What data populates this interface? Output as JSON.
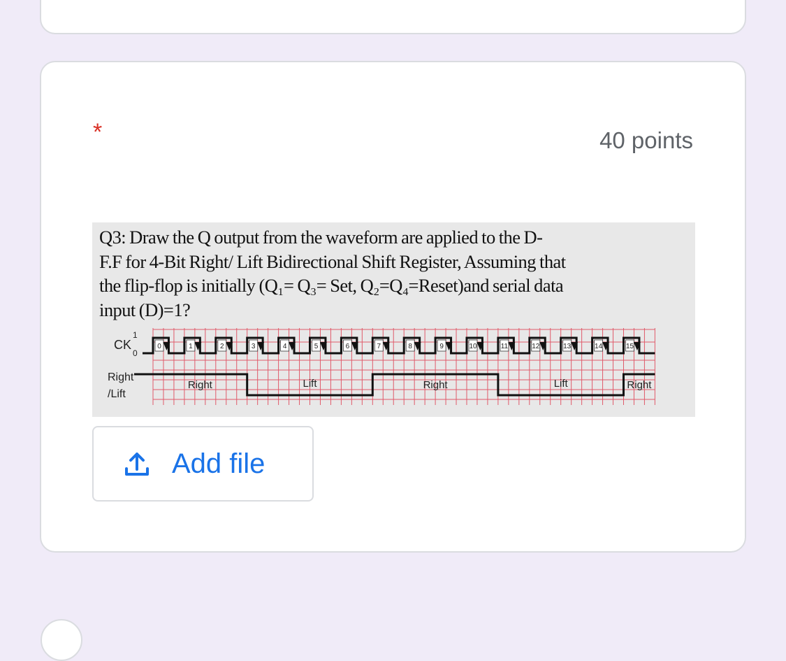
{
  "question": {
    "required_marker": "*",
    "points_label": "40 points",
    "text_lines": [
      "Q3: Draw the Q output from the waveform are  applied to the D-",
      "F.F for 4-Bit Right/ Lift Bidirectional Shift Register, Assuming that",
      "the flip-flop is initially (Q₁= Q₃= Set, Q₂=Q₄=Reset)and serial data",
      "input (D)=1?"
    ],
    "diagram": {
      "ck_label": "CK",
      "ck_high_label": "1",
      "ck_low_label": "0",
      "rl_label_line1": "Right",
      "rl_label_line2": "/Lift",
      "clock_numbers": [
        "0",
        "1",
        "2",
        "3",
        "4",
        "5",
        "6",
        "7",
        "8",
        "9",
        "10",
        "11",
        "12",
        "13",
        "14",
        "15"
      ],
      "segments": [
        {
          "label": "Right",
          "level": "high",
          "from_clock": 0,
          "to_clock": 3
        },
        {
          "label": "Lift",
          "level": "low",
          "from_clock": 3,
          "to_clock": 7
        },
        {
          "label": "Right",
          "level": "high",
          "from_clock": 7,
          "to_clock": 11
        },
        {
          "label": "Lift",
          "level": "low",
          "from_clock": 11,
          "to_clock": 15
        },
        {
          "label": "Right",
          "level": "high",
          "from_clock": 15,
          "to_clock": 16
        }
      ]
    }
  },
  "upload": {
    "icon": "upload-icon",
    "label": "Add file"
  },
  "colors": {
    "background": "#f0ebf8",
    "accent": "#1a73e8",
    "required": "#d93025",
    "grid": "#e05a6a"
  }
}
